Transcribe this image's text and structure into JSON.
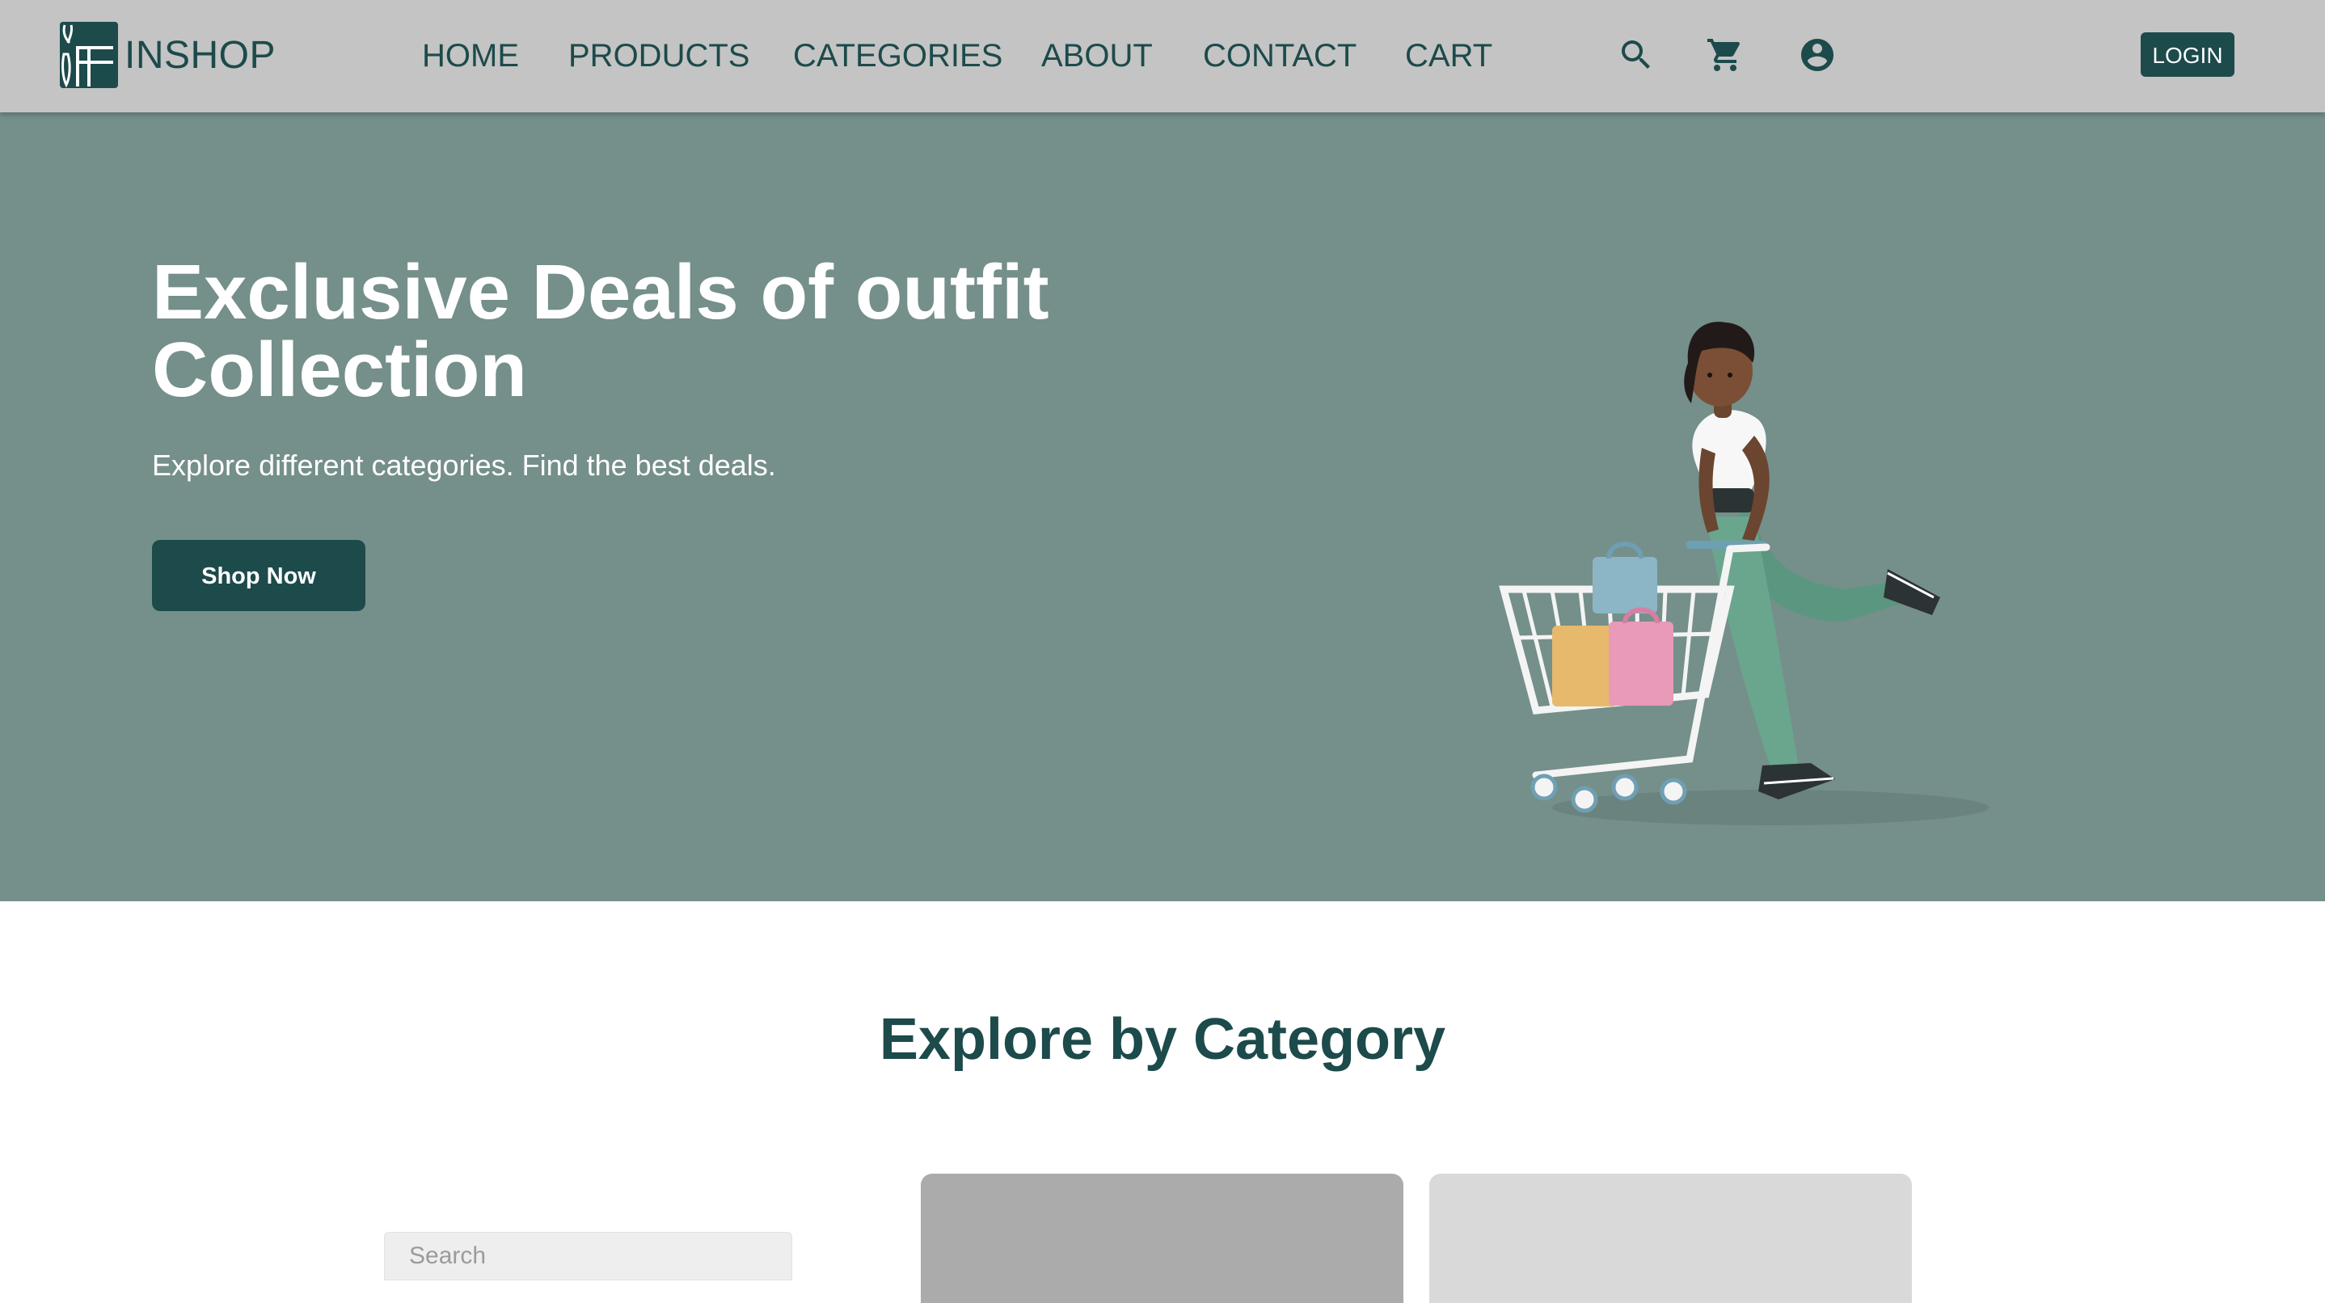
{
  "brand": {
    "name": "INSHOP"
  },
  "nav": {
    "items": [
      {
        "label": "HOME"
      },
      {
        "label": "PRODUCTS"
      },
      {
        "label": "CATEGORIES"
      },
      {
        "label": "ABOUT"
      },
      {
        "label": "CONTACT"
      },
      {
        "label": "CART"
      }
    ]
  },
  "header_icons": [
    "search-icon",
    "cart-icon",
    "account-circle-icon"
  ],
  "login": {
    "label": "LOGIN"
  },
  "hero": {
    "title": "Exclusive Deals of outfit Collection",
    "subtitle": "Explore different categories. Find the best deals.",
    "cta_label": "Shop Now",
    "illustration": "woman-pushing-shopping-cart-illustration"
  },
  "categories": {
    "title": "Explore by Category",
    "search_placeholder": "Search"
  },
  "colors": {
    "header_bg": "#c4c4c4",
    "brand_dark": "#1d4a4a",
    "hero_bg": "#758f8a",
    "card_dark": "#ababab",
    "card_light": "#d9d9d9"
  }
}
